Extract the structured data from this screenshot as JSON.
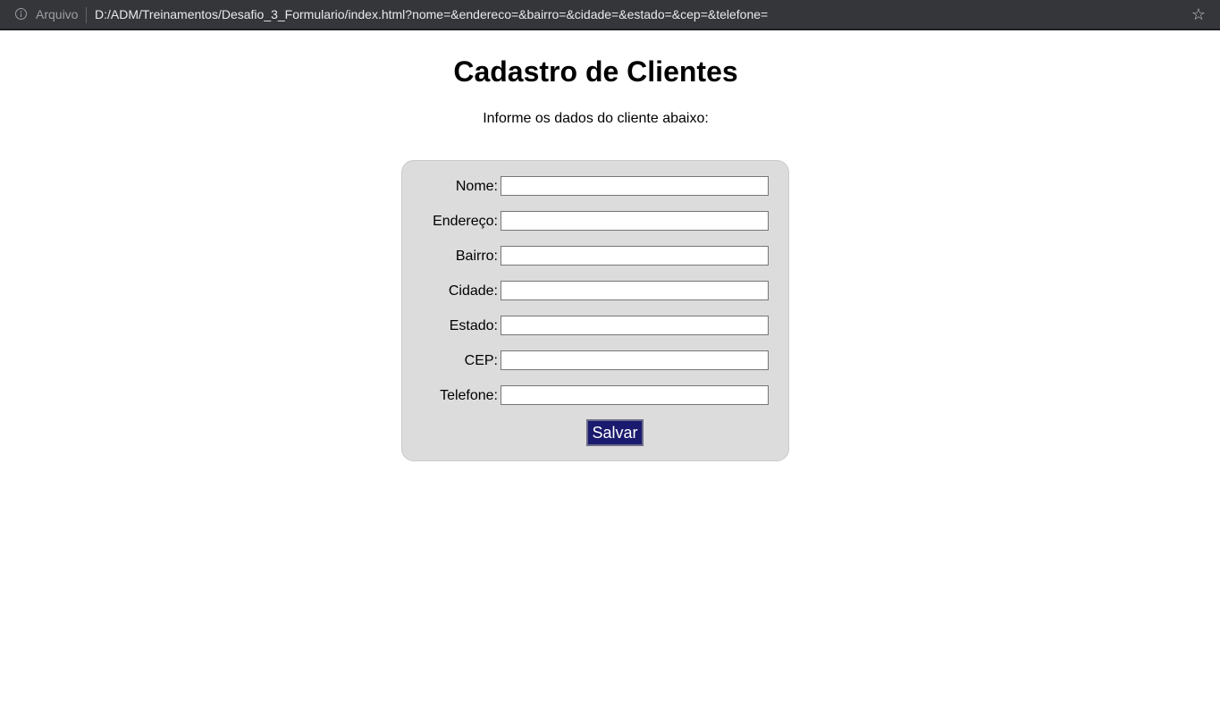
{
  "browser": {
    "security_label": "Arquivo",
    "url": "D:/ADM/Treinamentos/Desafio_3_Formulario/index.html?nome=&endereco=&bairro=&cidade=&estado=&cep=&telefone=",
    "info_icon": "info-icon",
    "bookmark_icon": "star-icon",
    "bookmark_glyph": "☆"
  },
  "page": {
    "title": "Cadastro de Clientes",
    "subtitle": "Informe os dados do cliente abaixo:"
  },
  "form": {
    "fields": [
      {
        "label": "Nome:",
        "value": ""
      },
      {
        "label": "Endereço:",
        "value": ""
      },
      {
        "label": "Bairro:",
        "value": ""
      },
      {
        "label": "Cidade:",
        "value": ""
      },
      {
        "label": "Estado:",
        "value": ""
      },
      {
        "label": "CEP:",
        "value": ""
      },
      {
        "label": "Telefone:",
        "value": ""
      }
    ],
    "submit_label": "Salvar"
  },
  "colors": {
    "browser_bar": "#35363a",
    "form_background": "#dcdcdc",
    "button_background": "#1a1a6e",
    "button_text": "#ffffff"
  }
}
